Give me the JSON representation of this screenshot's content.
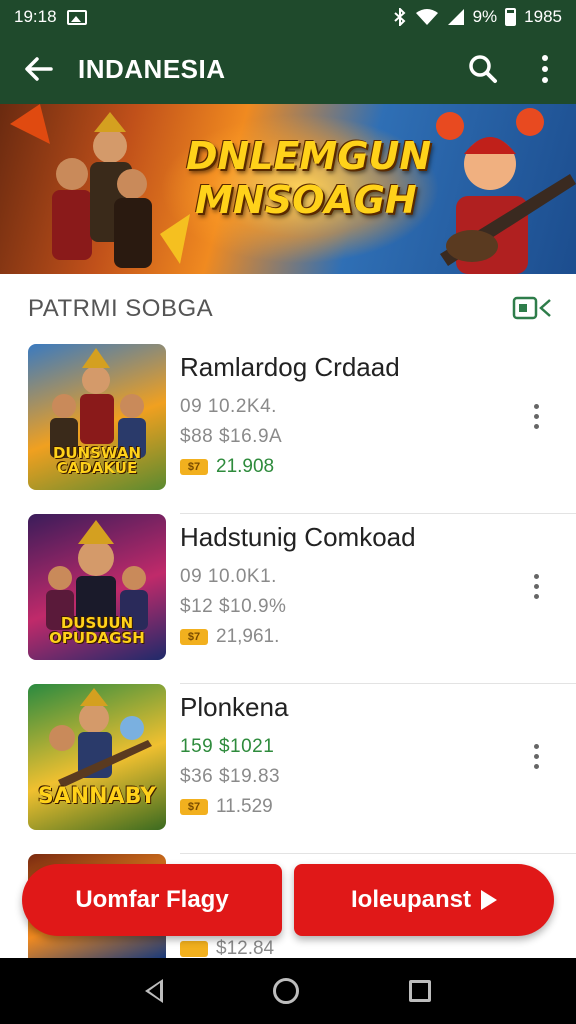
{
  "status_bar": {
    "time": "19:18",
    "battery_text": "9%",
    "clock_right": "1985",
    "icons": [
      "gallery-icon",
      "bluetooth-icon",
      "wifi-icon",
      "signal-icon",
      "battery-icon"
    ]
  },
  "app_bar": {
    "title": "INDANESIA",
    "back_icon": "arrow-left-icon",
    "search_icon": "search-icon",
    "more_icon": "more-vert-icon"
  },
  "banner": {
    "title_line1": "DNLEMGUN",
    "title_line2": "MNSOAGH"
  },
  "section": {
    "title": "PATRMI SOBGA",
    "action_icon": "cast-icon"
  },
  "items": [
    {
      "title": "Ramlardog Crdaad",
      "line1": "09  10.2K4.",
      "line2": "$88  $16.9A",
      "price": "21.908",
      "coin_label": "$7",
      "thumb_label": "DUNSWAN CADAKUE",
      "thumb_colors": [
        "#3a7ac0",
        "#f0a020",
        "#5a8a30"
      ]
    },
    {
      "title": "Hadstunig Comkoad",
      "line1": "09  10.0K1.",
      "line2": "$12  $10.9%",
      "price": "21,961.",
      "coin_label": "$7",
      "thumb_label": "DUSUUN OPUDAGSH",
      "thumb_colors": [
        "#3a1c5a",
        "#c02a6a",
        "#1e2a6a"
      ]
    },
    {
      "title": "Plonkena",
      "line1": "159  $1021",
      "line2": "$36  $19.83",
      "price": "11.529",
      "coin_label": "$7",
      "thumb_label": "SANNABY",
      "thumb_colors": [
        "#2a8a40",
        "#f0c030",
        "#3a6a20"
      ]
    },
    {
      "price_partial": "$12.84",
      "thumb_colors": [
        "#7a2a10",
        "#f08a20",
        "#1a3a7a"
      ]
    }
  ],
  "buttons": {
    "left_label": "Uomfar Flagy",
    "right_label": "Ioleupanst"
  },
  "nav": {
    "back_icon": "nav-back-icon",
    "home_icon": "nav-home-icon",
    "recents_icon": "nav-recents-icon"
  }
}
